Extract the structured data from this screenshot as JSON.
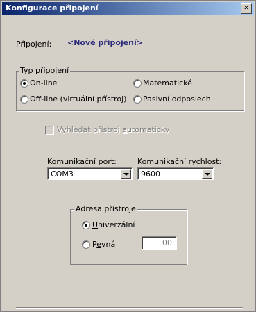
{
  "window": {
    "title": "Konfigurace připojení",
    "close_glyph": "✕"
  },
  "connection": {
    "label": "Připojení:",
    "value": "<Nové připojení>"
  },
  "connection_type": {
    "legend": "Typ připojení",
    "options": [
      {
        "label": "On-line",
        "selected": true
      },
      {
        "label": "Off-line (virtuální přístroj)",
        "selected": false
      },
      {
        "label": "Matematické",
        "selected": false
      },
      {
        "label": "Pasivní odposlech",
        "selected": false
      }
    ]
  },
  "auto_search": {
    "label_before": "Vyhledat přístroj ",
    "label_accel": "a",
    "label_after": "utomaticky",
    "checked": false,
    "enabled": false
  },
  "port": {
    "label_before": "Komunikační ",
    "label_accel": "p",
    "label_after": "ort:",
    "value": "COM3"
  },
  "speed": {
    "label_before": "Komunikační ",
    "label_accel": "r",
    "label_after": "ychlost:",
    "value": "9600"
  },
  "device_address": {
    "legend": "Adresa přístroje",
    "universal": {
      "label_accel": "U",
      "label_after": "niverzální",
      "selected": true
    },
    "fixed": {
      "label_before": "P",
      "label_accel": "e",
      "label_after": "vná",
      "selected": false,
      "value": "00"
    }
  }
}
